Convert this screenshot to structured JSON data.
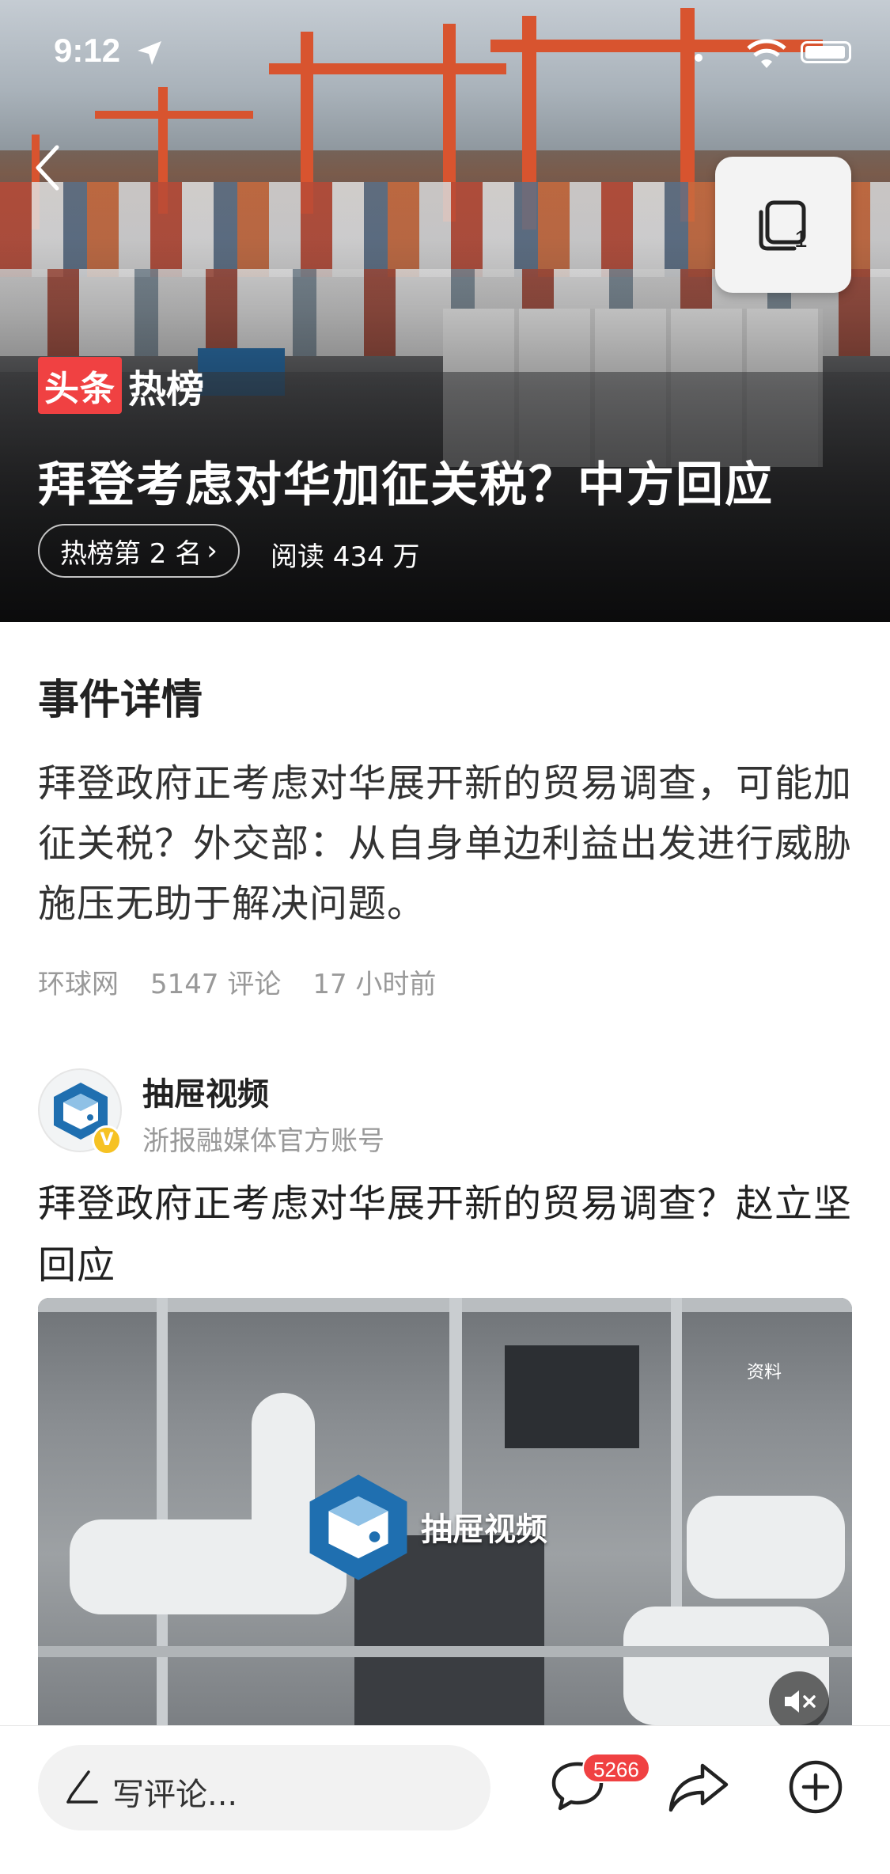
{
  "status_bar": {
    "time": "9:12"
  },
  "hero": {
    "brand_red": "头条",
    "brand_white": "热榜",
    "title": "拜登考虑对华加征关税？中方回应",
    "rank_label": "热榜第 2 名",
    "reads": "阅读 434 万",
    "float_count": "1"
  },
  "event": {
    "section_title": "事件详情",
    "body": "拜登政府正考虑对华展开新的贸易调查，可能加征关税？外交部：从自身单边利益出发进行威胁施压无助于解决问题。",
    "source": "环球网",
    "comments": "5147 评论",
    "time_ago": "17 小时前"
  },
  "post": {
    "author": "抽屉视频",
    "author_desc": "浙报融媒体官方账号",
    "verified_mark": "V",
    "title": "拜登政府正考虑对华展开新的贸易调查？赵立坚回应",
    "video_logo_text": "抽屉视频",
    "video_tag": "资料"
  },
  "bottom_bar": {
    "comment_placeholder": "写评论...",
    "comment_count": "5266"
  },
  "colors": {
    "brand_red": "#f04142",
    "verified_yellow": "#f6c223",
    "muted_text": "#999999"
  }
}
